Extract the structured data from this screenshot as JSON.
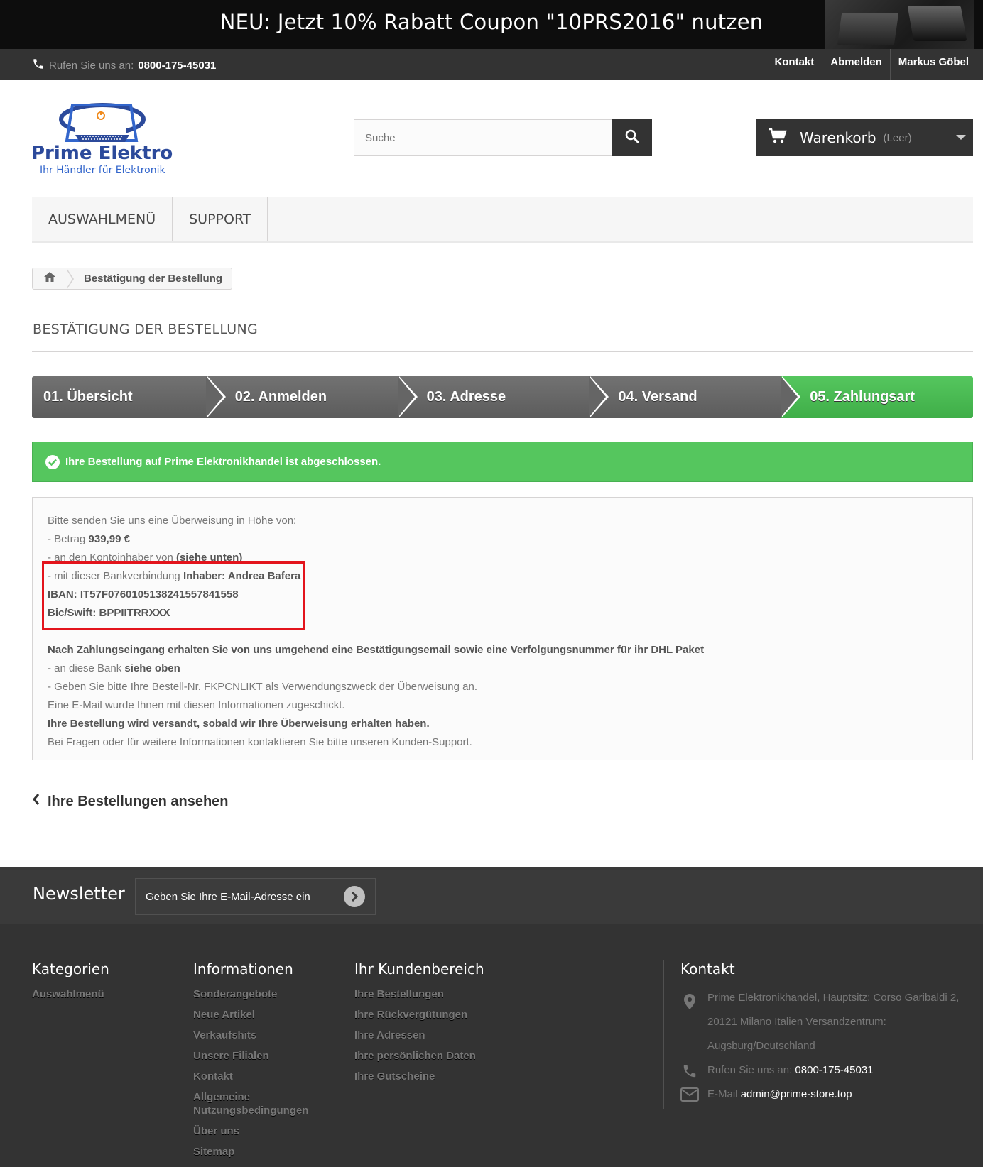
{
  "banner": {
    "text": "NEU: Jetzt 10% Rabatt Coupon \"10PRS2016\" nutzen"
  },
  "topbar": {
    "phone_label": "Rufen Sie uns an:",
    "phone_number": "0800-175-45031",
    "links": [
      "Kontakt",
      "Abmelden",
      "Markus Göbel"
    ]
  },
  "logo": {
    "name": "Prime Elektro",
    "tagline": "Ihr Händler für Elektronik"
  },
  "search": {
    "placeholder": "Suche"
  },
  "cart": {
    "label": "Warenkorb",
    "status": "(Leer)"
  },
  "menu": {
    "items": [
      "AUSWAHLMENÜ",
      "SUPPORT"
    ]
  },
  "breadcrumb": {
    "current": "Bestätigung der Bestellung"
  },
  "page": {
    "heading": "BESTÄTIGUNG DER BESTELLUNG"
  },
  "steps": [
    "01. Übersicht",
    "02. Anmelden",
    "03. Adresse",
    "04. Versand",
    "05. Zahlungsart"
  ],
  "alert": {
    "text": "Ihre Bestellung auf Prime Elektronikhandel ist abgeschlossen."
  },
  "payment": {
    "intro": "Bitte senden Sie uns eine Überweisung in Höhe von:",
    "amount_prefix": "- Betrag ",
    "amount": "939,99 €",
    "owner_prefix": "- an den Kontoinhaber von ",
    "owner": "(siehe unten)",
    "bank_prefix": "- mit dieser Bankverbindung ",
    "bank_holder": "Inhaber: Andrea Bafera",
    "iban": "IBAN: IT57F0760105138241557841558",
    "bic": "Bic/Swift: BPPIITRRXXX",
    "confirm_note": "Nach Zahlungseingang erhalten Sie von uns umgehend eine Bestätigungsemail sowie eine Verfolgungsnummer für ihr DHL Paket",
    "bank_line_prefix": "- an diese Bank ",
    "bank_line": "siehe oben",
    "reference": "- Geben Sie bitte Ihre Bestell-Nr. FKPCNLIKT als Verwendungszweck der Überweisung an.",
    "email_sent": "Eine E-Mail wurde Ihnen mit diesen Informationen zugeschickt.",
    "shipping_note": "Ihre Bestellung wird versandt, sobald wir Ihre Überweisung erhalten haben.",
    "support_note": "Bei Fragen oder für weitere Informationen kontaktieren Sie bitte unseren Kunden-Support."
  },
  "back_link": {
    "label": "Ihre Bestellungen ansehen"
  },
  "newsletter": {
    "title": "Newsletter",
    "placeholder": "Geben Sie Ihre E-Mail-Adresse ein"
  },
  "footer": {
    "categories": {
      "title": "Kategorien",
      "items": [
        "Auswahlmenü"
      ]
    },
    "information": {
      "title": "Informationen",
      "items": [
        "Sonderangebote",
        "Neue Artikel",
        "Verkaufshits",
        "Unsere Filialen",
        "Kontakt",
        "Allgemeine Nutzungsbedingungen",
        "Über uns",
        "Sitemap"
      ]
    },
    "account": {
      "title": "Ihr Kundenbereich",
      "items": [
        "Ihre Bestellungen",
        "Ihre Rückvergütungen",
        "Ihre Adressen",
        "Ihre persönlichen Daten",
        "Ihre Gutscheine"
      ]
    },
    "contact": {
      "title": "Kontakt",
      "address": "Prime Elektronikhandel, Hauptsitz: Corso Garibaldi 2, 20121 Milano Italien Versandzentrum: Augsburg/Deutschland",
      "phone_label": "Rufen Sie uns an:",
      "phone_number": "0800-175-45031",
      "email_label": "E-Mail",
      "email": "admin@prime-store.top"
    }
  },
  "colors": {
    "green": "#55c65e",
    "dark": "#333333",
    "highlight_red": "#e3141c",
    "logo_blue": "#2c4a9b",
    "logo_orange": "#f08a1c"
  }
}
